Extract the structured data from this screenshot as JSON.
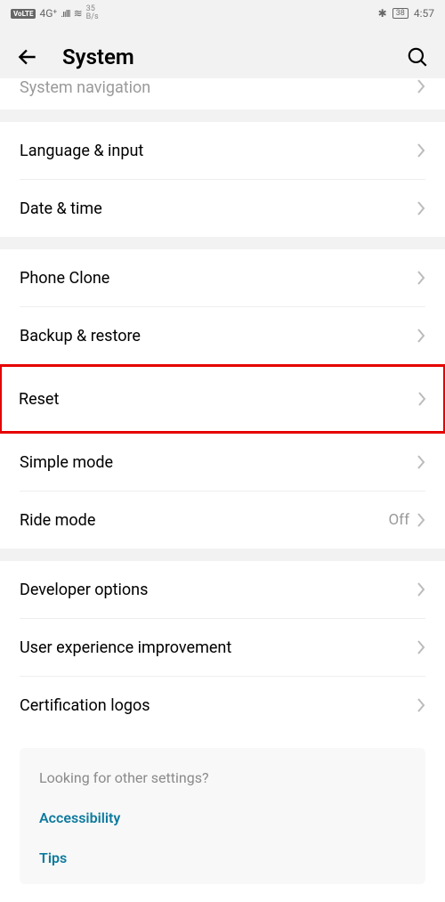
{
  "status": {
    "volte": "VoLTE",
    "net": "4G⁺",
    "signal": ".ıılll",
    "wifi": "≋",
    "bytes_top": "35",
    "bytes_bottom": "B/s",
    "bluetooth": "✱",
    "battery": "38",
    "time": "4:57"
  },
  "header": {
    "title": "System"
  },
  "rows": {
    "system_navigation": "System navigation",
    "language_input": "Language & input",
    "date_time": "Date & time",
    "phone_clone": "Phone Clone",
    "backup_restore": "Backup & restore",
    "reset": "Reset",
    "simple_mode": "Simple mode",
    "ride_mode": "Ride mode",
    "ride_mode_value": "Off",
    "developer_options": "Developer options",
    "user_experience": "User experience improvement",
    "certification_logos": "Certification logos"
  },
  "footer": {
    "heading": "Looking for other settings?",
    "accessibility": "Accessibility",
    "tips": "Tips"
  }
}
